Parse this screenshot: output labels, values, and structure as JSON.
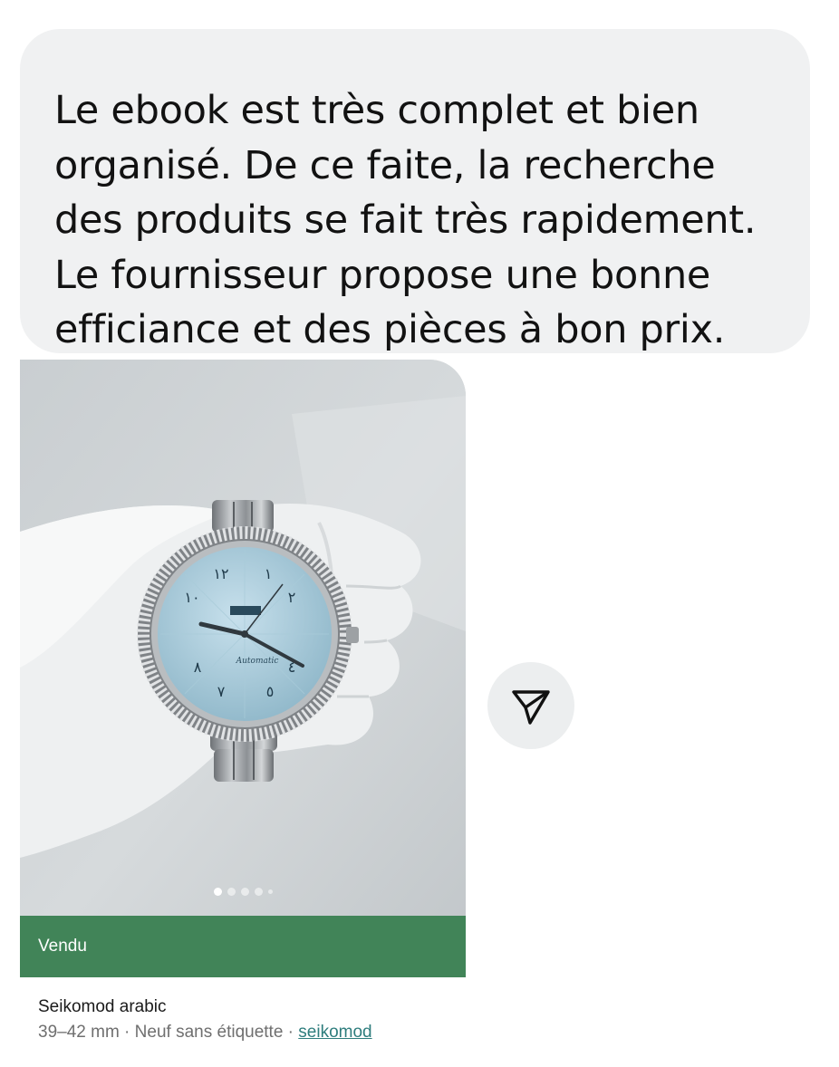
{
  "message": {
    "text": "Le ebook est très complet et bien\norganisé. De ce faite, la recherche\ndes produits se fait très rapidement.\nLe fournisseur propose une bonne\nefficiance et des pièces à bon prix."
  },
  "listing": {
    "image_icon": "wristwatch-photo",
    "status_label": "Vendu",
    "status_color": "#418458",
    "title": "Seikomod arabic",
    "size": "39–42 mm",
    "separator": " · ",
    "condition": "Neuf sans étiquette",
    "brand_link": "seikomod",
    "carousel": {
      "total": 5,
      "active_index": 1
    }
  },
  "actions": {
    "share_icon": "send-icon"
  }
}
